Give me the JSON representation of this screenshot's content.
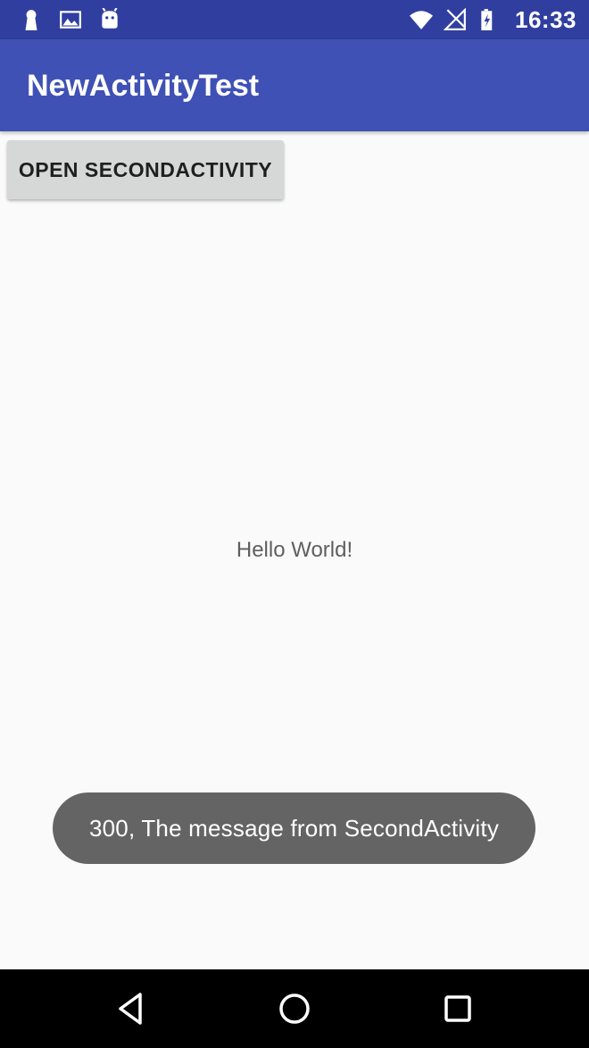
{
  "status_bar": {
    "time": "16:33",
    "left_icons": [
      "keyhole-icon",
      "image-icon",
      "android-icon"
    ],
    "right_icons": [
      "wifi-icon",
      "signal-off-icon",
      "battery-charging-icon"
    ]
  },
  "app_bar": {
    "title": "NewActivityTest"
  },
  "main": {
    "open_button_label": "OPEN SECONDACTIVITY",
    "hello_text": "Hello World!"
  },
  "toast": {
    "message": "300, The message from SecondActivity"
  },
  "nav_bar": {
    "buttons": [
      "back-icon",
      "home-icon",
      "recents-icon"
    ]
  },
  "colors": {
    "status_bar": "#303f9f",
    "app_bar": "#3f51b5",
    "background": "#fafafa",
    "button": "#d6d7d7",
    "toast": "#646464",
    "nav_bar": "#000000"
  }
}
